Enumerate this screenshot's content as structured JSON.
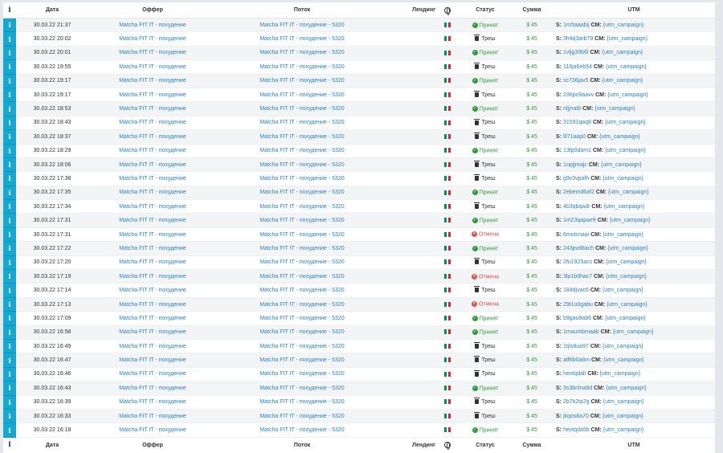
{
  "headers": {
    "info": "i",
    "date": "Дата",
    "offer": "Оффер",
    "stream": "Поток",
    "landing": "Лендинг",
    "geo": "globe-icon",
    "status": "Статус",
    "sum": "Сумма",
    "utm": "UTM"
  },
  "status_labels": {
    "ok": "Принят",
    "trash": "Треш",
    "cancel": "Отмена"
  },
  "flag_colors": [
    "#009246",
    "#ffffff",
    "#ce2b37"
  ],
  "rows": [
    {
      "date": "30.03.22 21:37",
      "offer": "Matcha FIT IT - похудение",
      "stream": "Matcha FIT IT - похудение - 5320",
      "status": "Принят",
      "status_type": "ok",
      "sum": "$ 45",
      "s": "1ro5aaabij",
      "cm": "{utm_campaign}"
    },
    {
      "date": "30.03.22 20:02",
      "offer": "Matcha FIT IT - похудение",
      "stream": "Matcha FIT IT - похудение - 5320",
      "status": "Треш",
      "status_type": "trash",
      "sum": "$ 45",
      "s": "3h4q3arb79",
      "cm": "{utm_campaign}"
    },
    {
      "date": "30.03.22 20:01",
      "offer": "Matcha FIT IT - похудение",
      "stream": "Matcha FIT IT - похудение - 5320",
      "status": "Принят",
      "status_type": "ok",
      "sum": "$ 45",
      "s": "1vljg39b6l",
      "cm": "{utm_campaign}"
    },
    {
      "date": "30.03.22 19:55",
      "offer": "Matcha FIT IT - похудение",
      "stream": "Matcha FIT IT - похудение - 5320",
      "status": "Треш",
      "status_type": "trash",
      "sum": "$ 45",
      "s": "118ja6eb54",
      "cm": "{utm_campaign}"
    },
    {
      "date": "30.03.22 19:17",
      "offer": "Matcha FIT IT - похудение",
      "stream": "Matcha FIT IT - похудение - 5320",
      "status": "Принят",
      "status_type": "ok",
      "sum": "$ 45",
      "s": "sc736jav5",
      "cm": "{utm_campaign}"
    },
    {
      "date": "30.03.22 19:17",
      "offer": "Matcha FIT IT - похудение",
      "stream": "Matcha FIT IT - похудение - 5320",
      "status": "Треш",
      "status_type": "trash",
      "sum": "$ 45",
      "s": "236po9aavv",
      "cm": "{utm_campaign}"
    },
    {
      "date": "30.03.22 18:53",
      "offer": "Matcha FIT IT - похудение",
      "stream": "Matcha FIT IT - похудение - 5320",
      "status": "Принят",
      "status_type": "ok",
      "sum": "$ 45",
      "s": "nljjnatb",
      "cm": "{utm_campaign}"
    },
    {
      "date": "30.03.22 18:43",
      "offer": "Matcha FIT IT - похудение",
      "stream": "Matcha FIT IT - похудение - 5320",
      "status": "Треш",
      "status_type": "trash",
      "sum": "$ 45",
      "s": "31591qaq8",
      "cm": "{utm_campaign}"
    },
    {
      "date": "30.03.22 18:37",
      "offer": "Matcha FIT IT - похудение",
      "stream": "Matcha FIT IT - похудение - 5320",
      "status": "Треш",
      "status_type": "trash",
      "sum": "$ 45",
      "s": "lll71aap0",
      "cm": "{utm_campaign}"
    },
    {
      "date": "30.03.22 18:29",
      "offer": "Matcha FIT IT - похудение",
      "stream": "Matcha FIT IT - похудение - 5320",
      "status": "Принят",
      "status_type": "ok",
      "sum": "$ 45",
      "s": "13fp0dam1",
      "cm": "{utm_campaign}"
    },
    {
      "date": "30.03.22 18:06",
      "offer": "Matcha FIT IT - похудение",
      "stream": "Matcha FIT IT - похудение - 5320",
      "status": "Треш",
      "status_type": "trash",
      "sum": "$ 45",
      "s": "1opjjreajc",
      "cm": "{utm_campaign}"
    },
    {
      "date": "30.03.22 17:38",
      "offer": "Matcha FIT IT - похудение",
      "stream": "Matcha FIT IT - похудение - 5320",
      "status": "Треш",
      "status_type": "trash",
      "sum": "$ 45",
      "s": "g9v3vpafh",
      "cm": "{utm_campaign}"
    },
    {
      "date": "30.03.22 17:35",
      "offer": "Matcha FIT IT - похудение",
      "stream": "Matcha FIT IT - похудение - 5320",
      "status": "Принят",
      "status_type": "ok",
      "sum": "$ 45",
      "s": "2ebemd6af2",
      "cm": "{utm_campaign}"
    },
    {
      "date": "30.03.22 17:34",
      "offer": "Matcha FIT IT - похудение",
      "stream": "Matcha FIT IT - похудение - 5320",
      "status": "Треш",
      "status_type": "trash",
      "sum": "$ 45",
      "s": "4b3qbqadr",
      "cm": "{utm_campaign}"
    },
    {
      "date": "30.03.22 17:31",
      "offer": "Matcha FIT IT - похудение",
      "stream": "Matcha FIT IT - похудение - 5320",
      "status": "Принят",
      "status_type": "ok",
      "sum": "$ 45",
      "s": "1m23qapae9",
      "cm": "{utm_campaign}"
    },
    {
      "date": "30.03.22 17:31",
      "offer": "Matcha FIT IT - похудение",
      "stream": "Matcha FIT IT - похудение - 5320",
      "status": "Отмена",
      "status_type": "cancel",
      "sum": "$ 45",
      "s": "6motcnaai",
      "cm": "{utm_campaign}"
    },
    {
      "date": "30.03.22 17:22",
      "offer": "Matcha FIT IT - похудение",
      "stream": "Matcha FIT IT - похудение - 5320",
      "status": "Принят",
      "status_type": "ok",
      "sum": "$ 45",
      "s": "243pvd8ach",
      "cm": "{utm_campaign}"
    },
    {
      "date": "30.03.22 17:20",
      "offer": "Matcha FIT IT - похудение",
      "stream": "Matcha FIT IT - похудение - 5320",
      "status": "Треш",
      "status_type": "trash",
      "sum": "$ 45",
      "s": "2fu1925acs",
      "cm": "{utm_campaign}"
    },
    {
      "date": "30.03.22 17:19",
      "offer": "Matcha FIT IT - похудение",
      "stream": "Matcha FIT IT - похудение - 5320",
      "status": "Отмена",
      "status_type": "cancel",
      "sum": "$ 45",
      "s": "3lp1b9hac7",
      "cm": "{utm_campaign}"
    },
    {
      "date": "30.03.22 17:14",
      "offer": "Matcha FIT IT - похудение",
      "stream": "Matcha FIT IT - похудение - 5320",
      "status": "Треш",
      "status_type": "trash",
      "sum": "$ 45",
      "s": "184djvac6",
      "cm": "{utm_campaign}"
    },
    {
      "date": "30.03.22 17:13",
      "offer": "Matcha FIT IT - похудение",
      "stream": "Matcha FIT IT - похудение - 5320",
      "status": "Отмена",
      "status_type": "cancel",
      "sum": "$ 45",
      "s": "29t1u0gabu",
      "cm": "{utm_campaign}"
    },
    {
      "date": "30.03.22 17:09",
      "offer": "Matcha FIT IT - похудение",
      "stream": "Matcha FIT IT - похудение - 5320",
      "status": "Принят",
      "status_type": "ok",
      "sum": "$ 45",
      "s": "b9gau9ab6",
      "cm": "{utm_campaign}"
    },
    {
      "date": "30.03.22 16:58",
      "offer": "Matcha FIT IT - похудение",
      "stream": "Matcha FIT IT - похудение - 5320",
      "status": "Принят",
      "status_type": "ok",
      "sum": "$ 45",
      "s": "1maumbmaab",
      "cm": "{utm_campaign}"
    },
    {
      "date": "30.03.22 16:49",
      "offer": "Matcha FIT IT - похудение",
      "stream": "Matcha FIT IT - похудение - 5320",
      "status": "Треш",
      "status_type": "trash",
      "sum": "$ 45",
      "s": "1tjls8ua97",
      "cm": "{utm_campaign}"
    },
    {
      "date": "30.03.22 16:47",
      "offer": "Matcha FIT IT - похудение",
      "stream": "Matcha FIT IT - похудение - 5320",
      "status": "Треш",
      "status_type": "trash",
      "sum": "$ 45",
      "s": "atf6b0a8m",
      "cm": "{utm_campaign}"
    },
    {
      "date": "30.03.22 16:46",
      "offer": "Matcha FIT IT - похудение",
      "stream": "Matcha FIT IT - похудение - 5320",
      "status": "Треш",
      "status_type": "trash",
      "sum": "$ 45",
      "s": "hevtqdalt",
      "cm": "{utm_campaign}"
    },
    {
      "date": "30.03.22 16:43",
      "offer": "Matcha FIT IT - похудение",
      "stream": "Matcha FIT IT - похудение - 5320",
      "status": "Принят",
      "status_type": "ok",
      "sum": "$ 45",
      "s": "3s3bnlna8d",
      "cm": "{utm_campaign}"
    },
    {
      "date": "30.03.22 16:39",
      "offer": "Matcha FIT IT - похудение",
      "stream": "Matcha FIT IT - похудение - 5320",
      "status": "Треш",
      "status_type": "trash",
      "sum": "$ 45",
      "s": "2b7k2ta7g",
      "cm": "{utm_campaign}"
    },
    {
      "date": "30.03.22 16:33",
      "offer": "Matcha FIT IT - похудение",
      "stream": "Matcha FIT IT - похудение - 5320",
      "status": "Треш",
      "status_type": "trash",
      "sum": "$ 45",
      "s": "jkqos8a70",
      "cm": "{utm_campaign}"
    },
    {
      "date": "30.03.22 16:18",
      "offer": "Matcha FIT IT - похудение",
      "stream": "Matcha FIT IT - похудение - 5320",
      "status": "Принят",
      "status_type": "ok",
      "sum": "$ 45",
      "s": "hevtqda5b",
      "cm": "{utm_campaign}"
    }
  ]
}
